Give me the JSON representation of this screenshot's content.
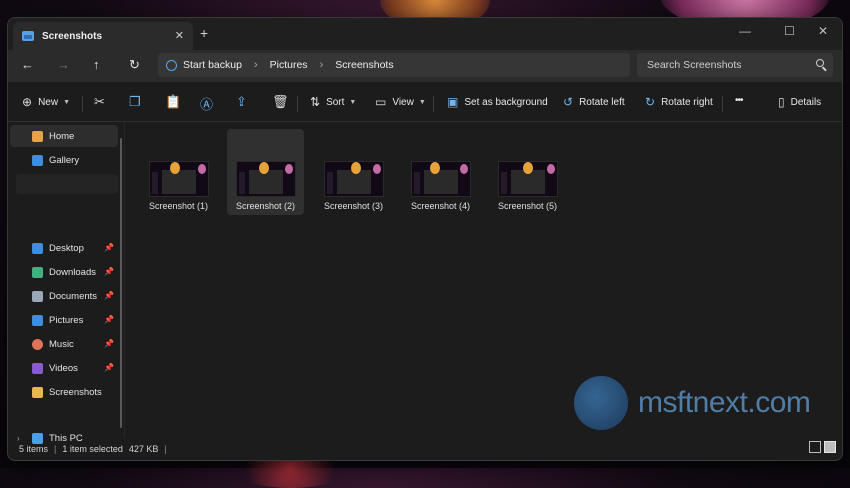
{
  "window": {
    "tab_title": "Screenshots",
    "new_tab": "+",
    "controls": {
      "minimize": "—",
      "maximize": "☐",
      "close": "✕"
    }
  },
  "nav": {
    "back": "←",
    "forward": "→",
    "up": "↑",
    "refresh": "↻",
    "breadcrumbs": [
      "Start backup",
      "Pictures",
      "Screenshots"
    ],
    "separator": "›",
    "search_placeholder": "Search Screenshots"
  },
  "toolbar": {
    "new_label": "New",
    "sort_label": "Sort",
    "view_label": "View",
    "set_background_label": "Set as background",
    "rotate_left_label": "Rotate left",
    "rotate_right_label": "Rotate right",
    "more_label": "•••",
    "details_label": "Details"
  },
  "sidebar": {
    "home": "Home",
    "gallery": "Gallery",
    "pinned": [
      {
        "label": "Desktop",
        "icon": "desktop-icon",
        "color": "#3b8ee0"
      },
      {
        "label": "Downloads",
        "icon": "download-icon",
        "color": "#3fb27f"
      },
      {
        "label": "Documents",
        "icon": "document-icon",
        "color": "#9aa7b8"
      },
      {
        "label": "Pictures",
        "icon": "pictures-icon",
        "color": "#3b8ee0"
      },
      {
        "label": "Music",
        "icon": "music-icon",
        "color": "#e0745a"
      },
      {
        "label": "Videos",
        "icon": "video-icon",
        "color": "#8a5ad0"
      },
      {
        "label": "Screenshots",
        "icon": "folder-icon",
        "color": "#e8b84a"
      }
    ],
    "this_pc": "This PC",
    "pin_glyph": "📌"
  },
  "files": [
    {
      "name": "Screenshot (1)",
      "selected": false
    },
    {
      "name": "Screenshot (2)",
      "selected": true
    },
    {
      "name": "Screenshot (3)",
      "selected": false
    },
    {
      "name": "Screenshot (4)",
      "selected": false
    },
    {
      "name": "Screenshot (5)",
      "selected": false
    }
  ],
  "status": {
    "count": "5 items",
    "selection": "1 item selected",
    "size": "427 KB",
    "bar": "|"
  },
  "watermark": "msftnext.com",
  "colors": {
    "accent": "#6fb6f3",
    "folder": "#e8b84a"
  }
}
